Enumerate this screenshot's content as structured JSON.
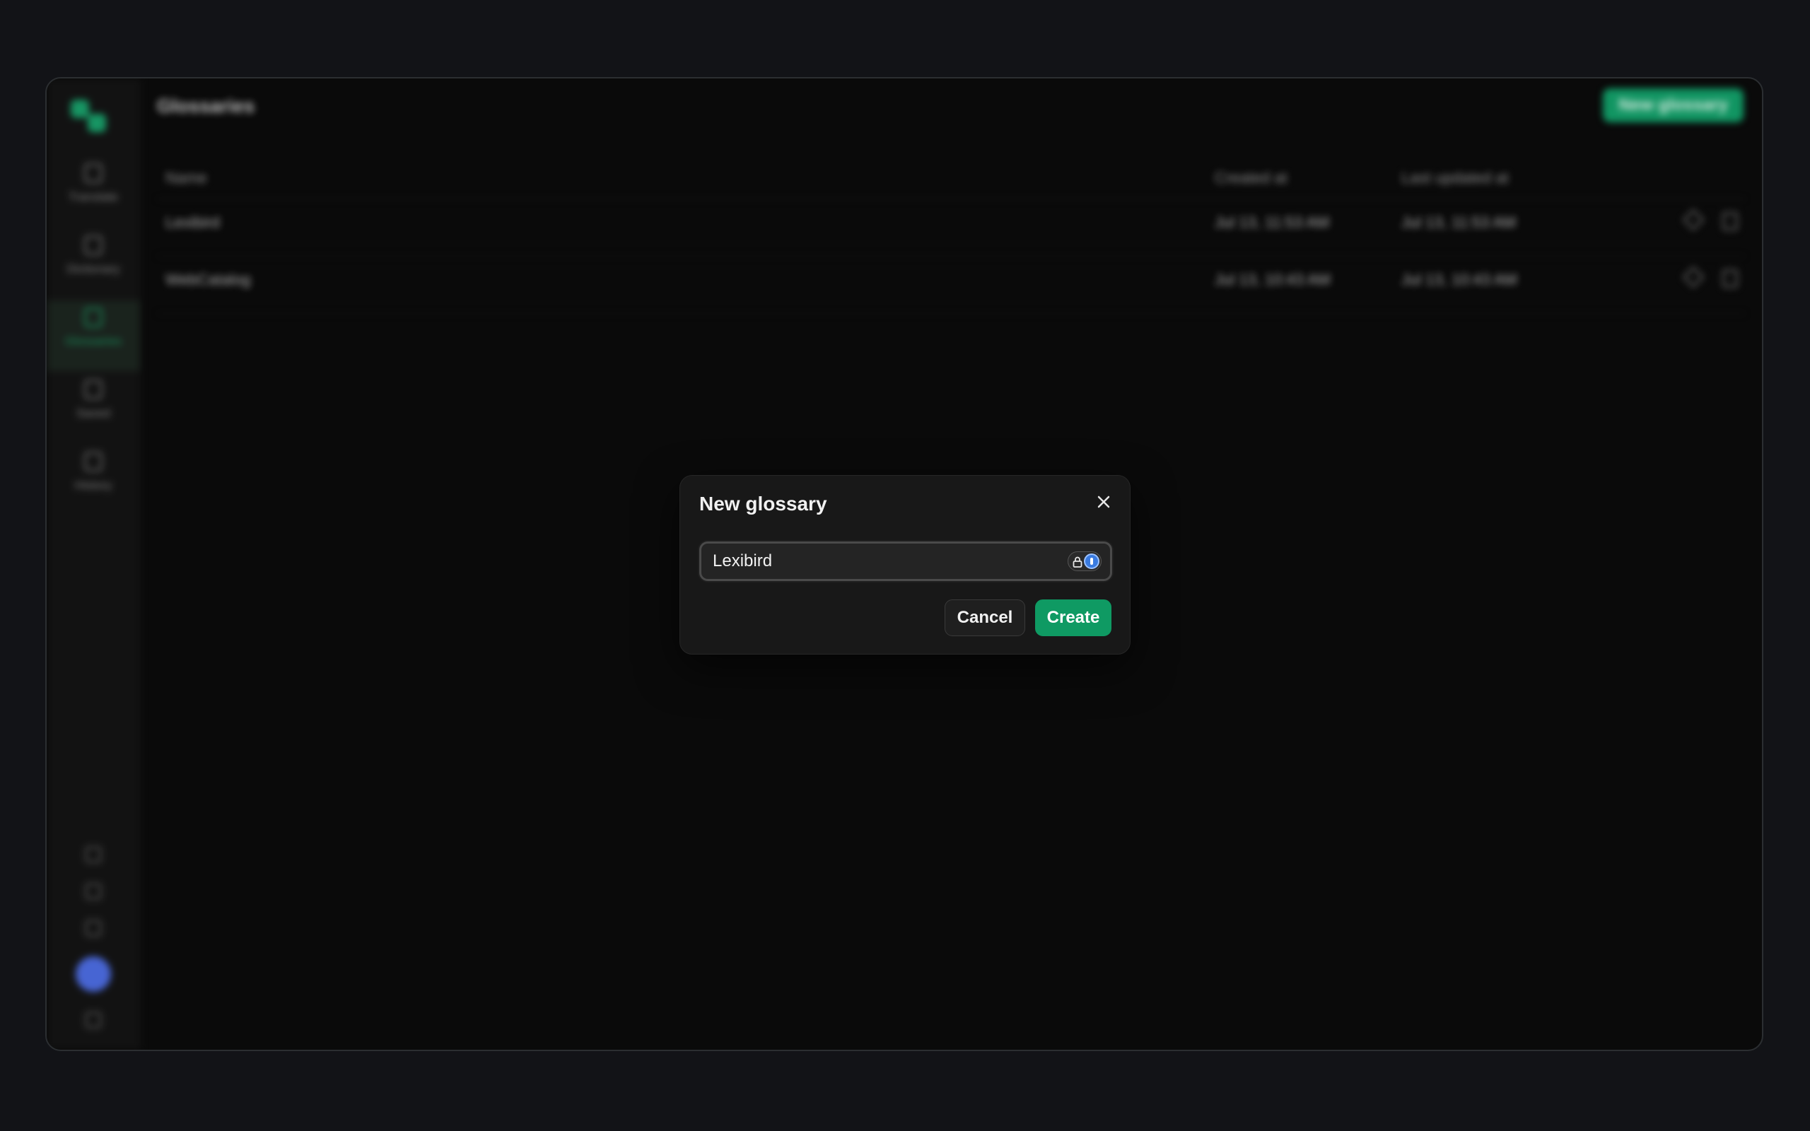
{
  "app": {
    "page_title": "Glossaries",
    "new_button_label": "New glossary"
  },
  "sidebar": {
    "items": [
      {
        "label": "Translate",
        "icon": "pen-icon"
      },
      {
        "label": "Dictionary",
        "icon": "book-icon"
      },
      {
        "label": "Glossaries",
        "icon": "glossary-icon",
        "active": true
      },
      {
        "label": "Saved",
        "icon": "bookmark-icon"
      },
      {
        "label": "History",
        "icon": "history-icon"
      }
    ],
    "bottom_icons": [
      "chat-icon",
      "settings-icon",
      "help-icon",
      "avatar",
      "collapse-icon"
    ]
  },
  "table": {
    "columns": [
      "Name",
      "Created at",
      "Last updated at"
    ],
    "rows": [
      {
        "name": "Lexibird",
        "created": "Jul 13, 11:53 AM",
        "updated": "Jul 13, 11:53 AM"
      },
      {
        "name": "WebCatalog",
        "created": "Jul 13, 10:43 AM",
        "updated": "Jul 13, 10:43 AM"
      }
    ]
  },
  "dialog": {
    "title": "New glossary",
    "input_value": "Lexibird",
    "cancel_label": "Cancel",
    "create_label": "Create"
  },
  "colors": {
    "accent": "#0f9a63",
    "background": "#121317",
    "dialog_bg": "#181818"
  }
}
